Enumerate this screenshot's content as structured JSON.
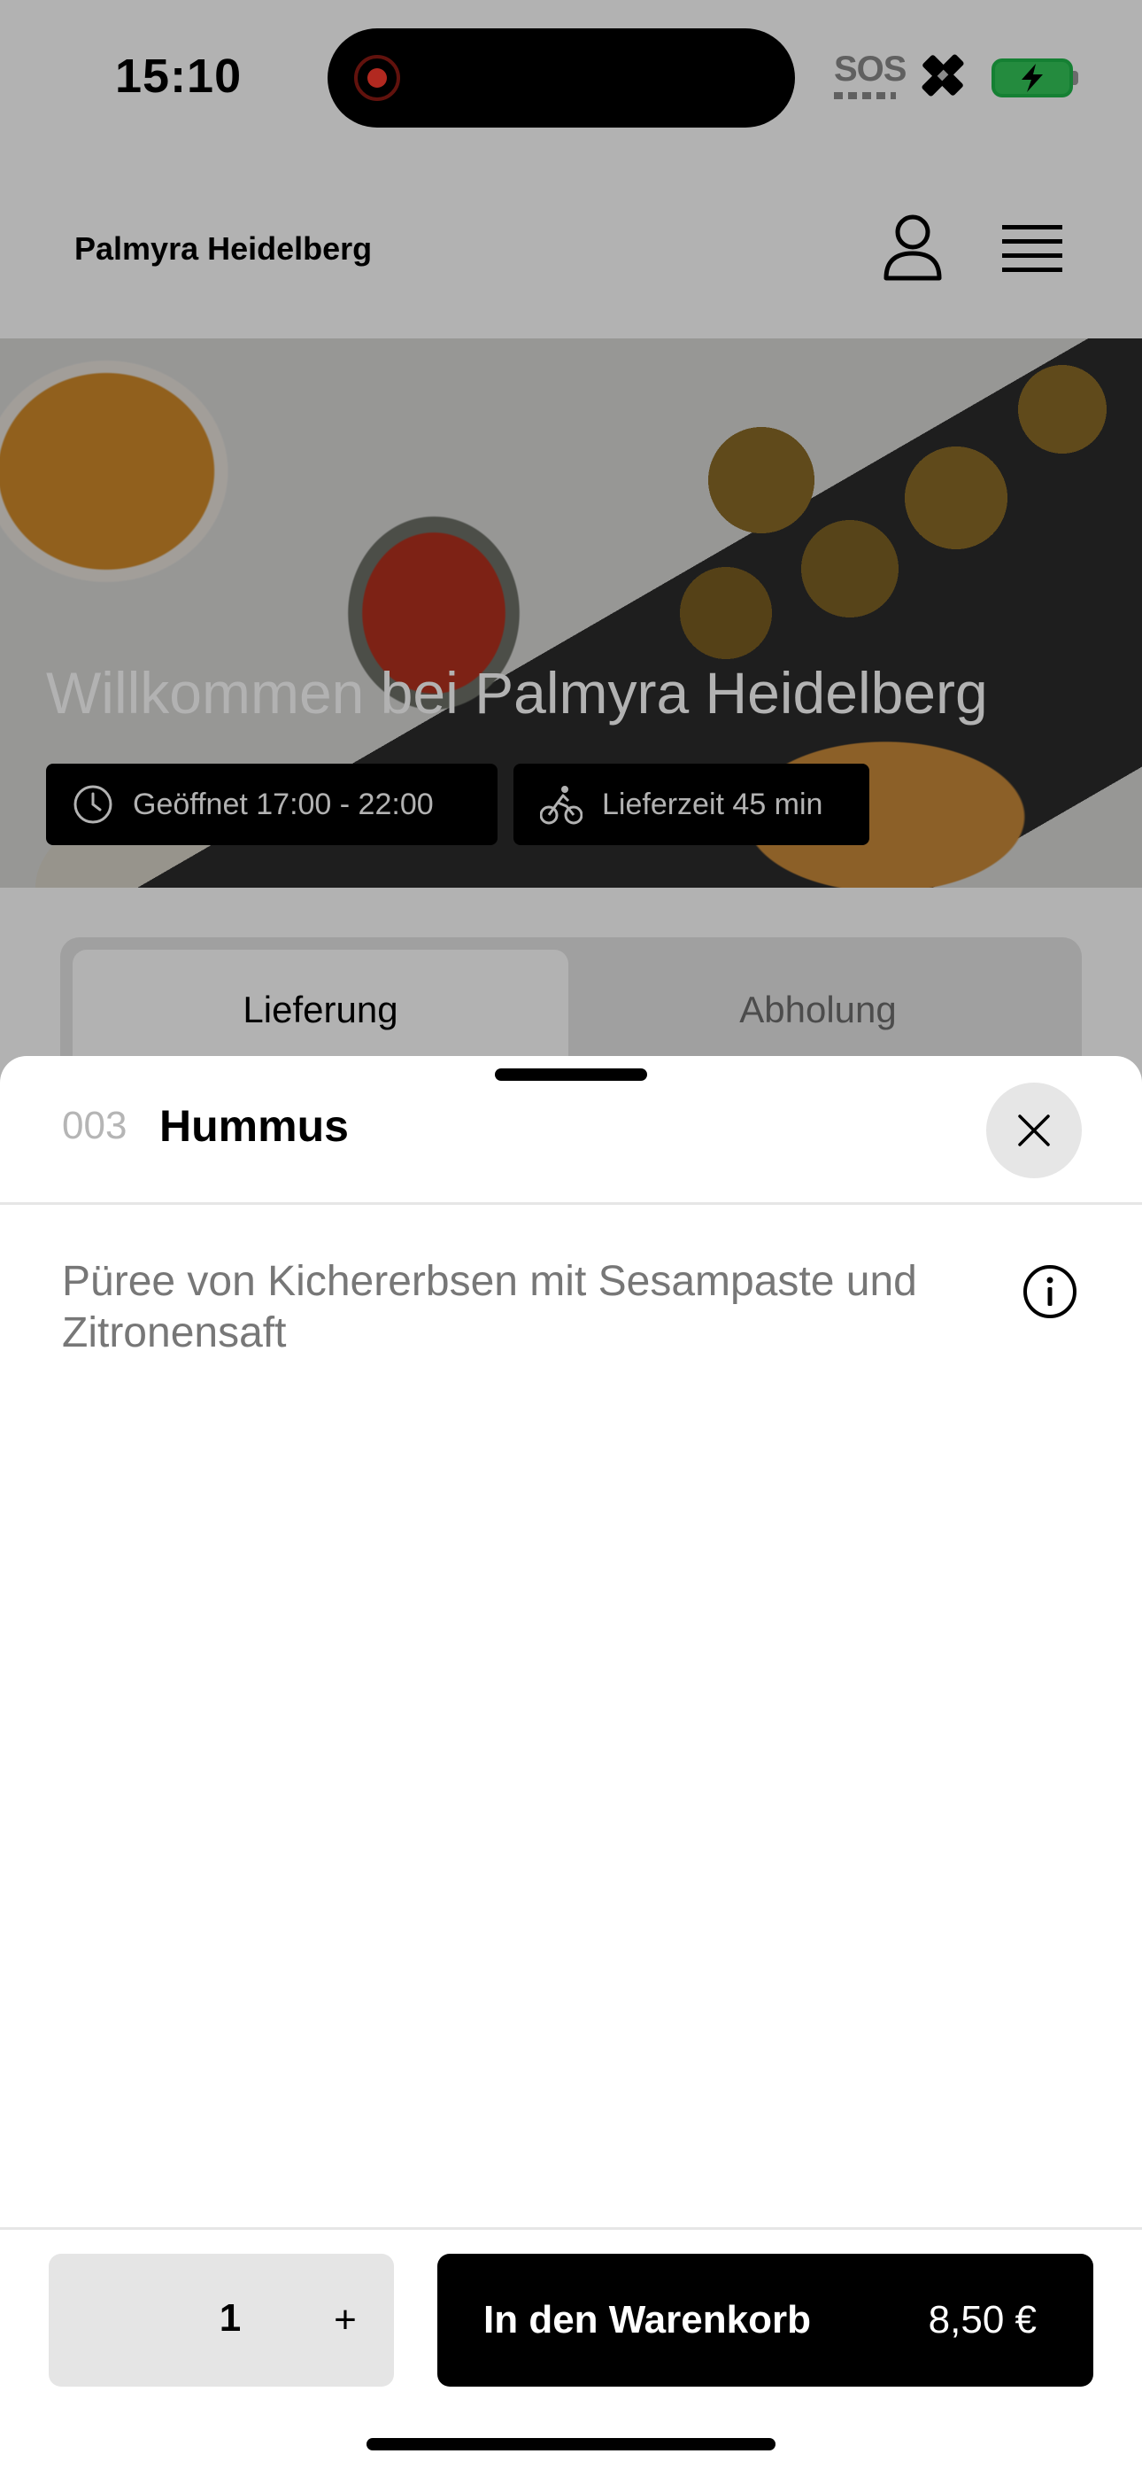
{
  "status_bar": {
    "time": "15:10",
    "sos": "SOS",
    "icons": [
      "screen-recording-icon",
      "satellite-icon",
      "battery-charging-icon"
    ],
    "colors": {
      "recording": "#ff3b2f",
      "battery": "#34c759"
    }
  },
  "header": {
    "brand": "Palmyra Heidelberg",
    "icons": [
      "user-icon",
      "hamburger-menu-icon"
    ]
  },
  "hero": {
    "title": "Willkommen bei Palmyra Heidelberg",
    "opening_hours": "Geöffnet 17:00 - 22:00",
    "delivery_time": "Lieferzeit 45 min",
    "icons": [
      "clock-icon",
      "cyclist-icon"
    ]
  },
  "mode_toggle": {
    "tabs": [
      {
        "label": "Lieferung",
        "active": true
      },
      {
        "label": "Abholung",
        "active": false
      }
    ]
  },
  "item_sheet": {
    "number": "003",
    "name": "Hummus",
    "description": "Püree von Kichererbsen mit Sesampaste und Zitronensaft",
    "icons": [
      "close-icon",
      "info-icon"
    ]
  },
  "footer": {
    "quantity": "1",
    "plus": "+",
    "add_to_cart_label": "In den Warenkorb",
    "price": "8,50 €"
  }
}
